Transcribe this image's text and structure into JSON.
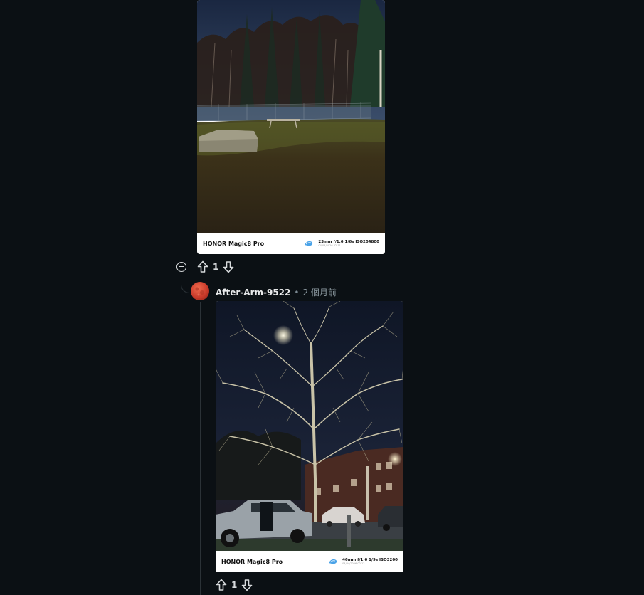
{
  "thread": {
    "first_comment": {
      "photo": {
        "device": "HONOR Magic8 Pro",
        "exif": "23mm  f/1.6  1/6s  ISO204800",
        "date": "04/04/2026 02:11"
      },
      "votes": {
        "count": "1"
      }
    },
    "reply": {
      "username": "After-Arm-9522",
      "separator": "•",
      "timestamp": "2 個月前",
      "photo": {
        "device": "HONOR Magic8 Pro",
        "exif": "46mm  f/1.6  1/9s  ISO3200",
        "date": "04/04/2026 02:12"
      },
      "votes": {
        "count": "1"
      }
    }
  },
  "colors": {
    "background": "#0b1014",
    "thread_line": "#2b3237",
    "text_primary": "#e8e9ea",
    "text_secondary": "#8b989f"
  }
}
